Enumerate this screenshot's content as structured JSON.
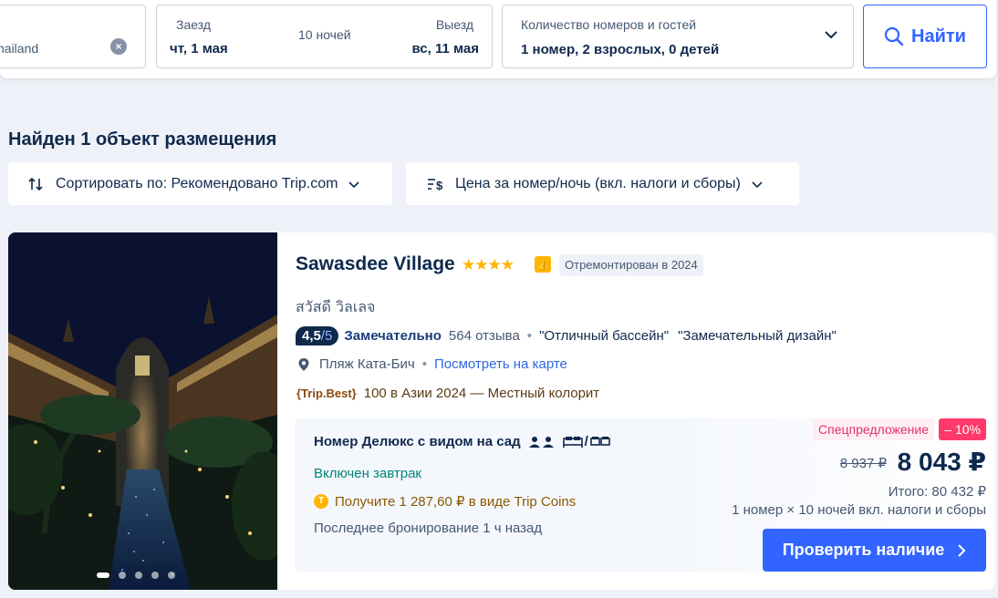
{
  "search": {
    "destination_value": "hailand",
    "checkin_label": "Заезд",
    "checkin_value": "чт, 1 мая",
    "nights": "10 ночей",
    "checkout_label": "Выезд",
    "checkout_value": "вс, 11 мая",
    "guests_label": "Количество номеров и гостей",
    "guests_value": "1 номер, 2 взрослых, 0 детей",
    "search_button": "Найти"
  },
  "results": {
    "title": "Найден 1 объект размещения",
    "sort_label": "Сортировать по: Рекомендовано Trip.com",
    "price_mode_label": "Цена за номер/ночь (вкл. налоги и сборы)"
  },
  "hotel": {
    "name": "Sawasdee Village",
    "stars": "★★★★",
    "star_count": 4,
    "renovated": "Отремонтирован в 2024",
    "local_name": "สวัสดี วิลเลจ",
    "score": "4,5",
    "score_max": "/5",
    "score_label": "Замечательно",
    "reviews": "564 отзыва",
    "highlights": [
      "\"Отличный бассейн\"",
      "\"Замечательный дизайн\""
    ],
    "area": "Пляж Ката-Бич",
    "map_link": "Посмотреть на карте",
    "award_badge": "{Trip.Best}",
    "award_text": "100 в Азии 2024 — Местный колорит",
    "photo_index": 1,
    "photo_count": 5,
    "room": {
      "name": "Номер Делюкс с видом на сад",
      "bed_separator": "/",
      "breakfast": "Включен завтрак",
      "coins": "Получите 1 287,60 ₽ в виде Trip Coins",
      "last_booking": "Последнее бронирование 1 ч назад"
    },
    "pricing": {
      "promo": "Спецпредложение",
      "discount": "– 10%",
      "old_price": "8 937 ₽",
      "new_price": "8 043 ₽",
      "total": "Итого: 80 432 ₽",
      "total_note": "1 номер × 10 ночей вкл. налоги и сборы",
      "check_button": "Проверить наличие"
    }
  },
  "colors": {
    "accent": "#3264ff",
    "navy": "#0f294d",
    "star": "#ffb400",
    "discount": "#ff3a6b",
    "breakfast": "#00857a"
  }
}
